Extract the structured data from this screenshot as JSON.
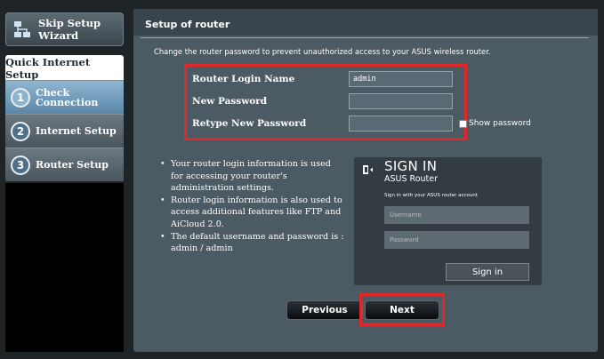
{
  "sidebar": {
    "skip_label": "Skip Setup Wizard",
    "qis_title": "Quick Internet Setup",
    "steps": [
      {
        "number": "1",
        "label": "Check Connection"
      },
      {
        "number": "2",
        "label": "Internet Setup"
      },
      {
        "number": "3",
        "label": "Router Setup"
      }
    ]
  },
  "page": {
    "title": "Setup of router",
    "description": "Change the router password to prevent unauthorized access to your ASUS wireless router."
  },
  "form": {
    "login_name_label": "Router Login Name",
    "login_name_value": "admin",
    "new_password_label": "New Password",
    "retype_password_label": "Retype New Password",
    "show_password_label": "Show password"
  },
  "info": {
    "items": [
      "Your router login information is used for accessing your router's administration settings.",
      "Router login information is also used to access additional features like FTP and AiCloud 2.0.",
      "The default username and password is : admin / admin"
    ]
  },
  "signin": {
    "title": "SIGN IN",
    "subtitle": "ASUS Router",
    "note": "Sign in with your ASUS router account",
    "username_placeholder": "Username",
    "password_placeholder": "Password",
    "button": "Sign in"
  },
  "nav": {
    "previous": "Previous",
    "next": "Next"
  },
  "colors": {
    "highlight": "#e0282b",
    "panel": "#4c5a63",
    "active_step": "#8fb6d1"
  }
}
